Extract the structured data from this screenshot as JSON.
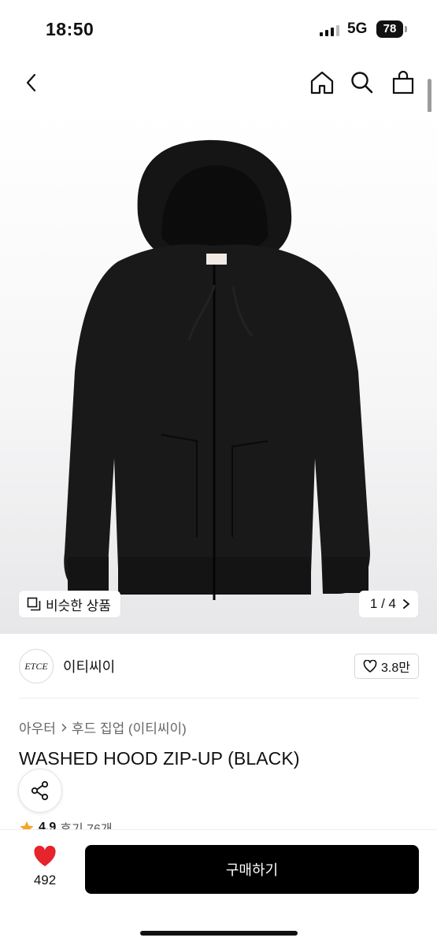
{
  "status_bar": {
    "time": "18:50",
    "network": "5G",
    "battery": "78"
  },
  "nav": {
    "back": "chevron-left-icon",
    "home": "home-icon",
    "search": "search-icon",
    "cart": "shopping-bag-icon"
  },
  "image": {
    "similar_label": "비슷한 상품",
    "page": "1 / 4"
  },
  "brand": {
    "logo_text": "ETCE",
    "name": "이티씨이",
    "likes": "3.8만"
  },
  "breadcrumb": {
    "category": "아우터",
    "subcategory": "후드 집업 (이티씨이)"
  },
  "product": {
    "title": "WASHED HOOD ZIP-UP (BLACK)",
    "rating": "4.9",
    "reviews": "후기 76개"
  },
  "bottom": {
    "heart_count": "492",
    "buy_label": "구매하기"
  },
  "colors": {
    "accent": "#000000",
    "heart": "#e5242b",
    "star": "#f5a623"
  }
}
